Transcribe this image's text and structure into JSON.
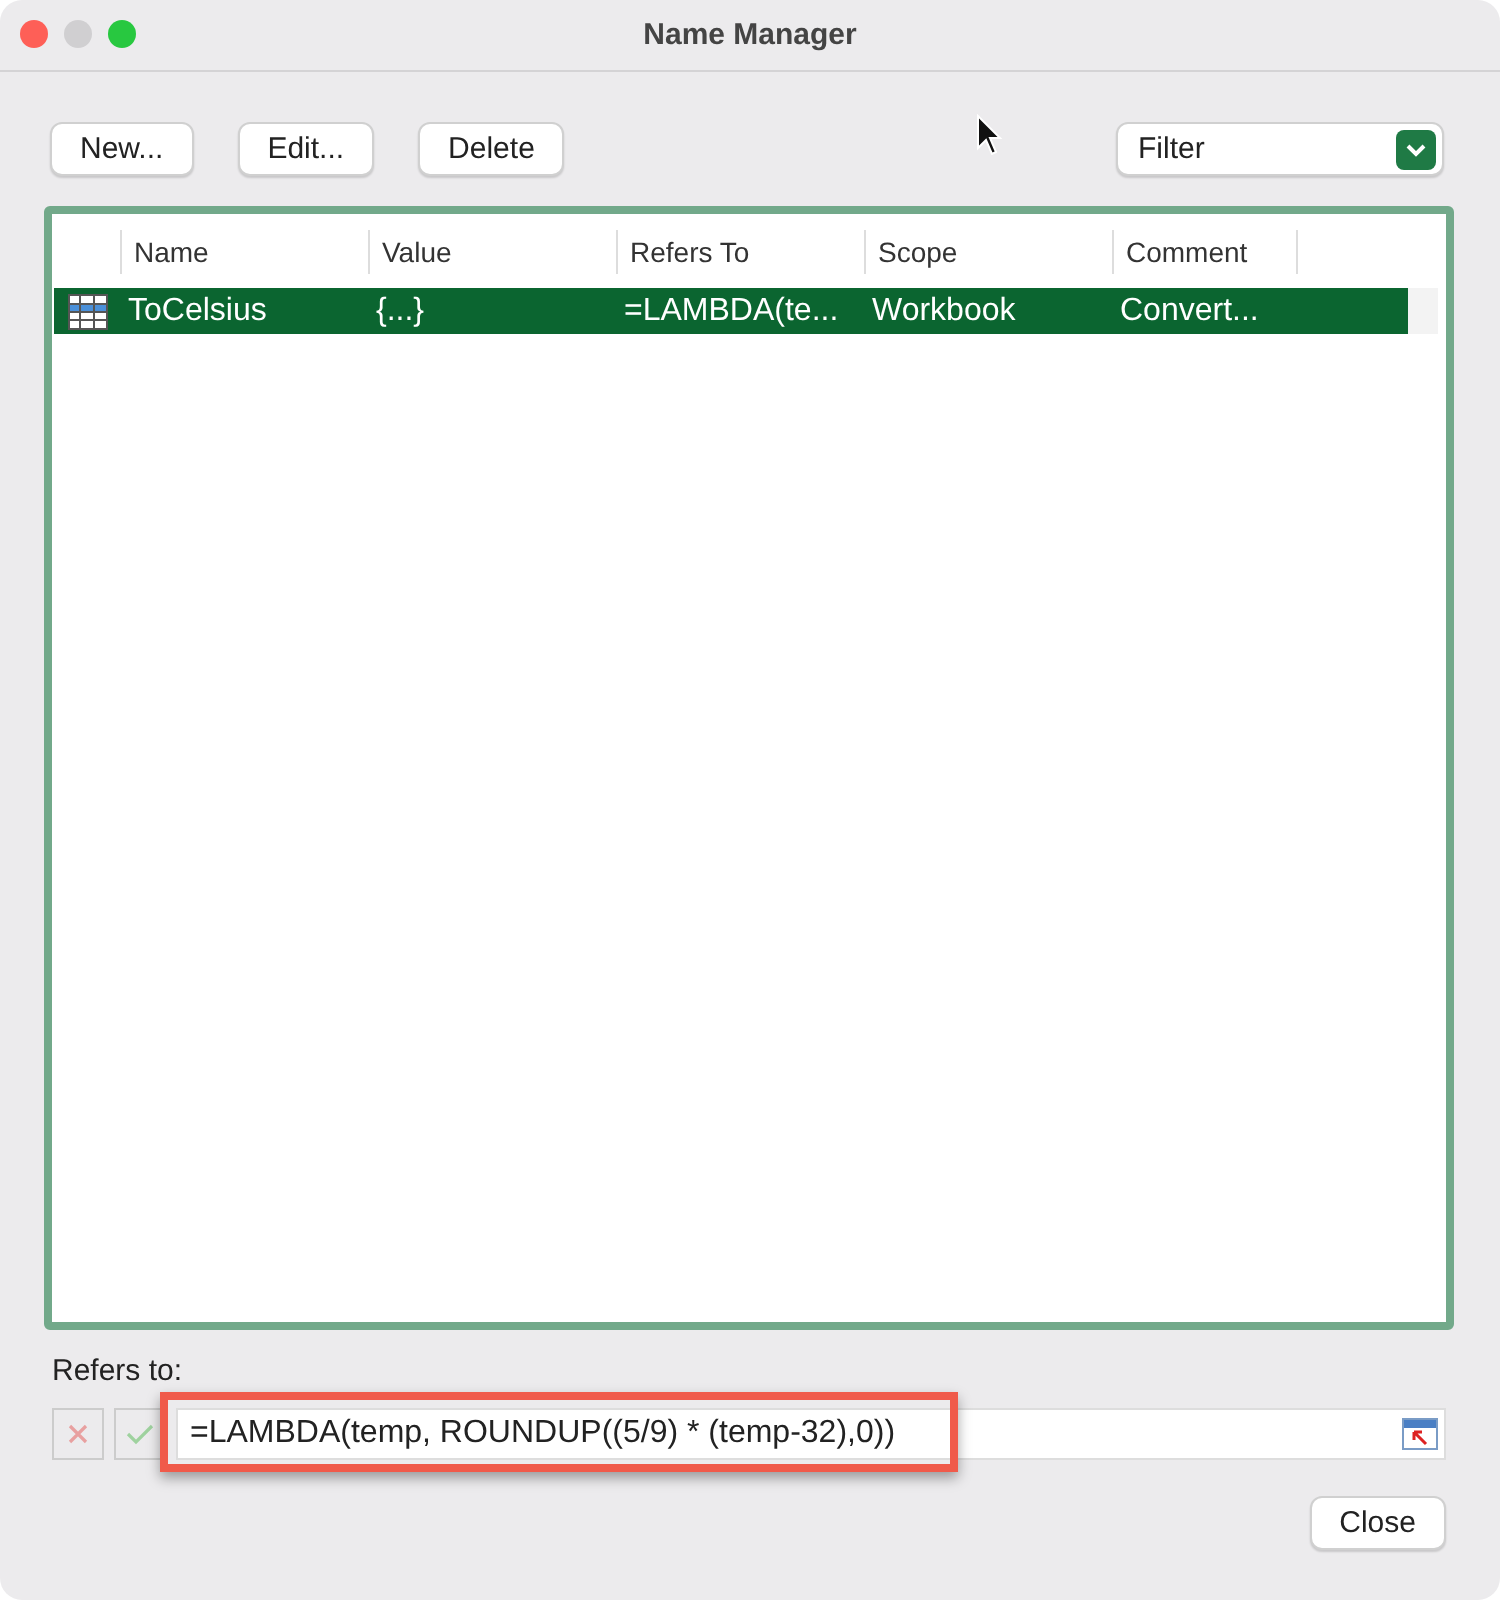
{
  "window": {
    "title": "Name Manager"
  },
  "toolbar": {
    "buttons": [
      {
        "label": "New..."
      },
      {
        "label": "Edit..."
      },
      {
        "label": "Delete"
      }
    ],
    "filter": {
      "value": "Filter"
    }
  },
  "table": {
    "columns": [
      "Name",
      "Value",
      "Refers To",
      "Scope",
      "Comment"
    ],
    "rows": [
      {
        "cells": [
          "ToCelsius",
          "{...}",
          "=LAMBDA(te...",
          "Workbook",
          "Convert..."
        ],
        "selected": true
      }
    ]
  },
  "refers_to": {
    "label": "Refers to:",
    "cancel_disabled": true,
    "confirm_disabled": true,
    "value": "=LAMBDA(temp, ROUNDUP((5/9) * (temp-32),0))",
    "highlighted": true
  },
  "close_button": {
    "label": "Close"
  }
}
